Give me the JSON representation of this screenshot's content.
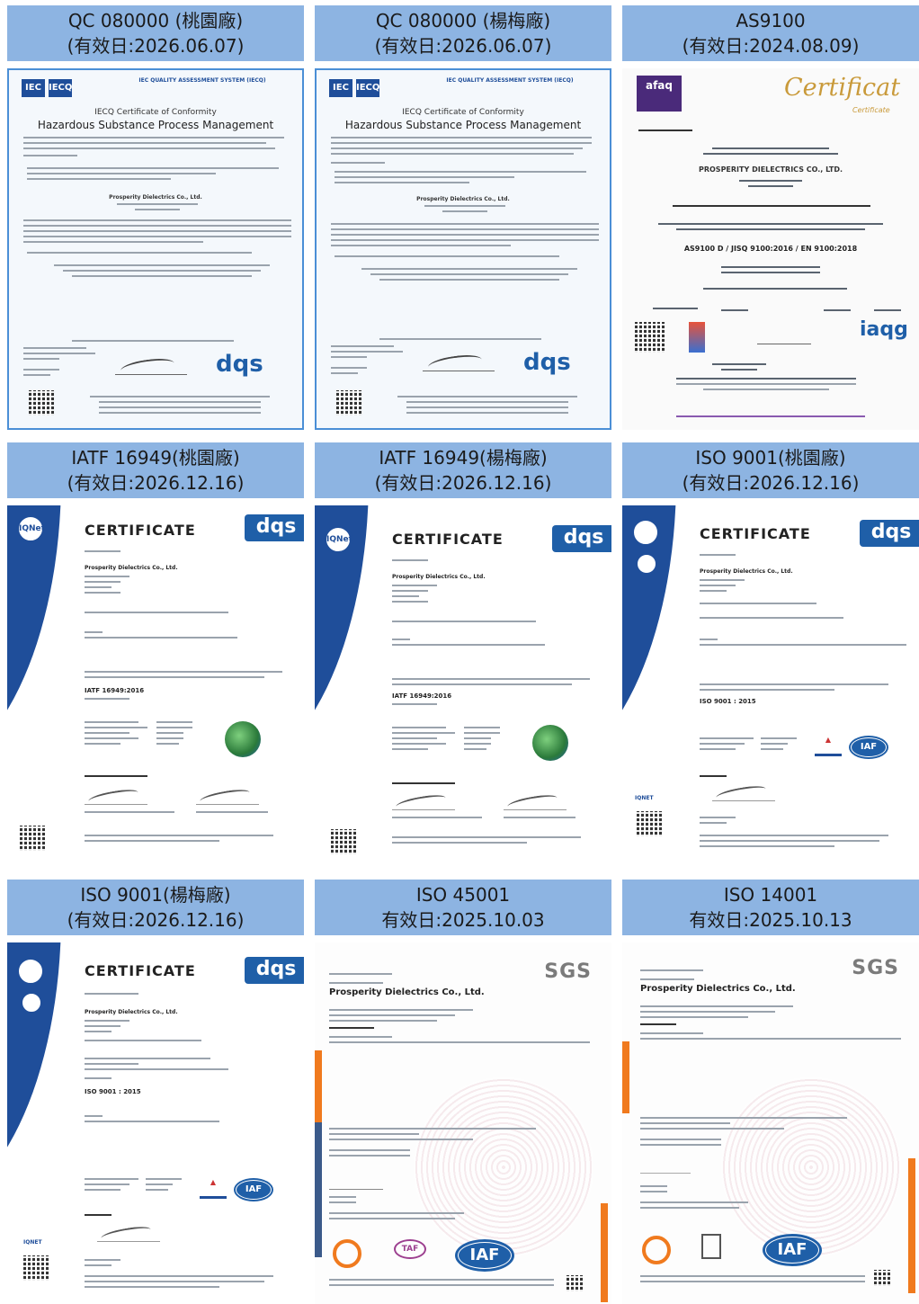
{
  "certificates": [
    {
      "line1": "QC 080000 (桃園廠)",
      "line2": "(有效日:2026.06.07)",
      "kind": "iecq",
      "doc": {
        "header": "IEC QUALITY ASSESSMENT SYSTEM (IECQ)",
        "subtitle": "IECQ Certificate of Conformity",
        "title": "Hazardous Substance Process Management",
        "company": "Prosperity Dielectrics Co., Ltd.",
        "brand": "dqs",
        "logo_a": "IEC",
        "logo_b": "IECQ"
      }
    },
    {
      "line1": "QC 080000 (楊梅廠)",
      "line2": "(有效日:2026.06.07)",
      "kind": "iecq",
      "doc": {
        "header": "IEC QUALITY ASSESSMENT SYSTEM (IECQ)",
        "subtitle": "IECQ Certificate of Conformity",
        "title": "Hazardous Substance Process Management",
        "company": "Prosperity Dielectrics Co., Ltd.",
        "brand": "dqs",
        "logo_a": "IEC",
        "logo_b": "IECQ"
      }
    },
    {
      "line1": "AS9100",
      "line2": "(有效日:2024.08.09)",
      "kind": "as9100",
      "doc": {
        "logo": "afaq",
        "title": "Certificat",
        "subtitle": "Certificate",
        "company": "PROSPERITY DIELECTRICS CO., LTD.",
        "standard": "AS9100 D / JISQ 9100:2016 / EN 9100:2018",
        "badge": "iaqg"
      }
    },
    {
      "line1": "IATF 16949(桃園廠)",
      "line2": "(有效日:2026.12.16)",
      "kind": "cert-iatf",
      "doc": {
        "title": "CERTIFICATE",
        "brand": "dqs",
        "company": "Prosperity Dielectrics Co., Ltd.",
        "standard": "IATF 16949:2016",
        "seal": "IQNet"
      }
    },
    {
      "line1": "IATF 16949(楊梅廠)",
      "line2": "(有效日:2026.12.16)",
      "kind": "cert-iatf",
      "doc": {
        "title": "CERTIFICATE",
        "brand": "dqs",
        "company": "Prosperity Dielectrics Co., Ltd.",
        "standard": "IATF 16949:2016",
        "seal": "IQNet"
      }
    },
    {
      "line1": "ISO 9001(桃園廠)",
      "line2": "(有效日:2026.12.16)",
      "kind": "cert-iso",
      "doc": {
        "title": "CERTIFICATE",
        "brand": "dqs",
        "company": "Prosperity Dielectrics Co., Ltd.",
        "standard": "ISO 9001 : 2015",
        "badge": "IAF",
        "seal": "IQNET"
      }
    },
    {
      "line1": "ISO 9001(楊梅廠)",
      "line2": "(有效日:2026.12.16)",
      "kind": "cert-iso",
      "doc": {
        "title": "CERTIFICATE",
        "brand": "dqs",
        "company": "Prosperity Dielectrics Co., Ltd.",
        "standard": "ISO 9001 : 2015",
        "badge": "IAF",
        "seal": "IQNET"
      }
    },
    {
      "line1": "ISO 45001",
      "line2": "有效日:2025.10.03",
      "kind": "sgs",
      "doc": {
        "brand": "SGS",
        "company": "Prosperity Dielectrics Co., Ltd.",
        "badge": "IAF",
        "taf": "TAF"
      }
    },
    {
      "line1": "ISO 14001",
      "line2": "有效日:2025.10.13",
      "kind": "sgs",
      "doc": {
        "brand": "SGS",
        "company": "Prosperity Dielectrics Co., Ltd.",
        "badge": "IAF",
        "taf": ""
      }
    }
  ],
  "colors": {
    "header_bg": "#8db4e2",
    "brand_blue": "#1f4e9a",
    "sgs_orange": "#f07a1e",
    "afaq_purple": "#4a2a7a",
    "certificat_gold": "#c99a3a"
  }
}
